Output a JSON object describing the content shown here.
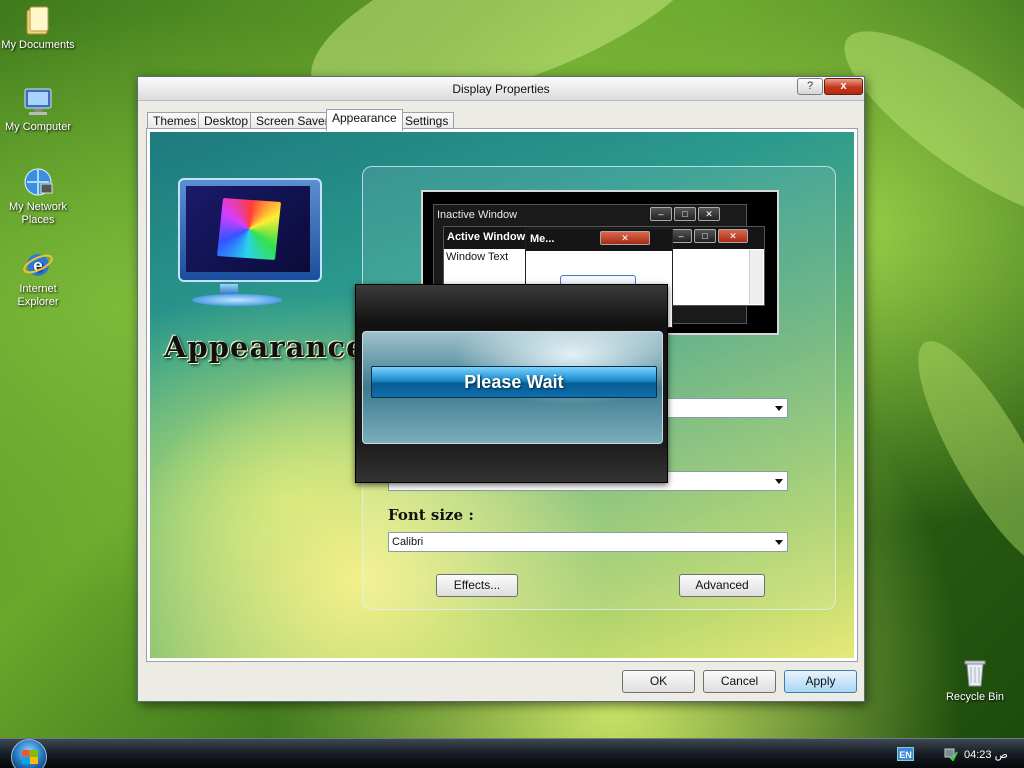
{
  "desktop": {
    "icons": [
      {
        "label": "My Documents",
        "icon": "folder-icon"
      },
      {
        "label": "My Computer",
        "icon": "computer-icon"
      },
      {
        "label": "My Network Places",
        "icon": "network-icon"
      },
      {
        "label": "Internet Explorer",
        "icon": "ie-icon"
      },
      {
        "label": "Recycle Bin",
        "icon": "recycle-bin-icon"
      }
    ]
  },
  "dialog": {
    "title": "Display Properties",
    "help_glyph": "?",
    "close_glyph": "x",
    "tabs": [
      "Themes",
      "Desktop",
      "Screen Saver",
      "Appearance",
      "Settings"
    ],
    "active_tab": "Appearance",
    "heading": "Appearance",
    "preview": {
      "inactive_title": "Inactive Window",
      "active_title": "Active Window",
      "window_text": "Window Text",
      "message_title": "Me..."
    },
    "dropdown_1_value": "",
    "dropdown_2_value": "",
    "font_size_label": "Font size :",
    "font_size_value": "Calibri",
    "effects_button": "Effects...",
    "advanced_button": "Advanced",
    "ok_button": "OK",
    "cancel_button": "Cancel",
    "apply_button": "Apply"
  },
  "wait_overlay": {
    "message": "Please Wait"
  },
  "taskbar": {
    "language": "EN",
    "clock": "ص 04:23"
  },
  "colors": {
    "accent": "#1b8ccd",
    "close_red": "#c4391c"
  }
}
